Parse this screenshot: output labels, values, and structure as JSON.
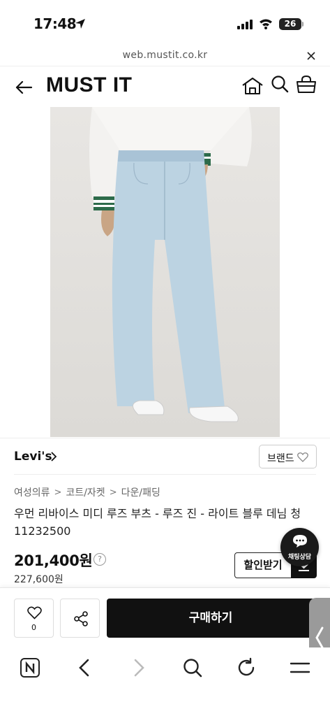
{
  "status_bar": {
    "time": "17:48",
    "battery": "26"
  },
  "browser": {
    "url": "web.mustit.co.kr"
  },
  "header": {
    "logo": "MUST IT"
  },
  "product": {
    "brand": "Levi's",
    "brand_chip_label": "브랜드",
    "breadcrumb": [
      "여성의류",
      "코트/자켓",
      "다운/패딩"
    ],
    "title": "우먼 리바이스 미디 루즈 부츠 - 루즈 진 - 라이트 블루 데님 청 11232500",
    "price": "201,400원",
    "price_help": "?",
    "original_price": "227,600원",
    "coupon_label": "할인받기"
  },
  "chat": {
    "label": "채팅상담"
  },
  "actions": {
    "like_count": "0",
    "buy_label": "구매하기"
  },
  "colors": {
    "primary": "#111111",
    "background": "#ffffff",
    "denim": "#bcd3e2"
  }
}
